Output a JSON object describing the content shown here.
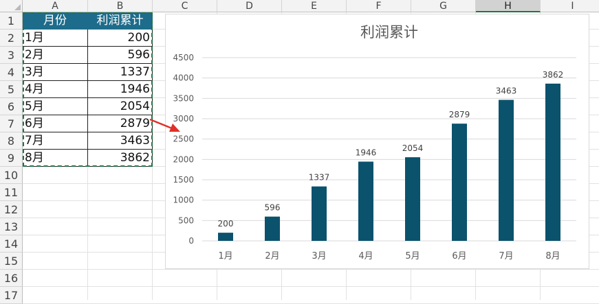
{
  "sheet": {
    "columns": [
      "A",
      "B",
      "C",
      "D",
      "E",
      "F",
      "G",
      "H",
      "I"
    ],
    "selected_column": "H",
    "rows": [
      "1",
      "2",
      "3",
      "4",
      "5",
      "6",
      "7",
      "8",
      "9",
      "10",
      "11",
      "12",
      "13",
      "14",
      "15",
      "16",
      "17"
    ]
  },
  "table": {
    "headers": [
      "月份",
      "利润累计"
    ],
    "rows": [
      [
        "1月",
        "200"
      ],
      [
        "2月",
        "596"
      ],
      [
        "3月",
        "1337"
      ],
      [
        "4月",
        "1946"
      ],
      [
        "5月",
        "2054"
      ],
      [
        "6月",
        "2879"
      ],
      [
        "7月",
        "3463"
      ],
      [
        "8月",
        "3862"
      ]
    ]
  },
  "colors": {
    "header_fill": "#1e6c8b",
    "bar_fill": "#0b526d",
    "arrow": "#e0302a",
    "marquee": "#217346"
  },
  "chart_data": {
    "type": "bar",
    "title": "利润累计",
    "categories": [
      "1月",
      "2月",
      "3月",
      "4月",
      "5月",
      "6月",
      "7月",
      "8月"
    ],
    "values": [
      200,
      596,
      1337,
      1946,
      2054,
      2879,
      3463,
      3862
    ],
    "yticks": [
      "0",
      "500",
      "1000",
      "1500",
      "2000",
      "2500",
      "3000",
      "3500",
      "4000",
      "4500"
    ],
    "ylim": [
      0,
      4500
    ],
    "xlabel": "",
    "ylabel": "",
    "grid": true,
    "legend": "none"
  }
}
